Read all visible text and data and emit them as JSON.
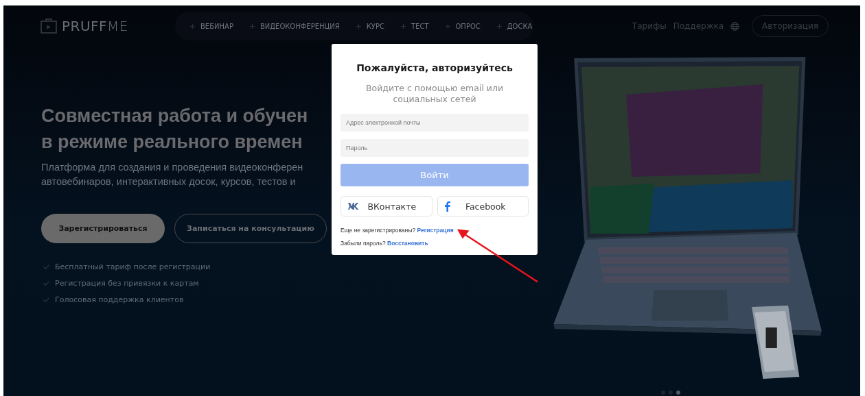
{
  "header": {
    "logo": "**PRUFF**ME",
    "nav": [
      "ВЕБИНАР",
      "ВИДЕОКОНФЕРЕНЦИЯ",
      "КУРС",
      "ТЕСТ",
      "ОПРОС",
      "ДОСКА"
    ],
    "links": [
      "Тарифы",
      "Поддержка"
    ],
    "login_button": "Авторизация"
  },
  "hero": {
    "headline_lines": [
      "Совместная работа и обучен",
      "в режиме реального времен"
    ],
    "subtitle_lines": [
      "Платформа для создания и проведения видеоконферен",
      "автовебинаров, интерактивных досок, курсов, тестов и"
    ],
    "primary_button": "Зарегистрироваться",
    "secondary_button": "Записаться на консультацию",
    "features": [
      "Бесплатный тариф после регистрации",
      "Регистрация без привязки к картам",
      "Голосовая поддержка клиентов"
    ]
  },
  "carousel_dots": [
    {
      "selected": false
    },
    {
      "selected": false
    },
    {
      "selected": true
    }
  ],
  "login_dialog": {
    "title": "Пожалуйста, авторизуйтесь",
    "subtitle": "Войдите с помощью email или социальных сетей",
    "email_placeholder": "Адрес электронной почты",
    "password_placeholder": "Пароль",
    "submit_button": "Войти",
    "social_buttons": [
      {
        "kind": "vk",
        "label": "ВКонтакте"
      },
      {
        "kind": "facebook",
        "label": "Facebook"
      }
    ],
    "register_prompt": {
      "text": "Еще не зарегистрированы?",
      "link": "Регистрация"
    },
    "restore_prompt": {
      "text": "Забыли пароль?",
      "link": "Восстановить"
    }
  }
}
